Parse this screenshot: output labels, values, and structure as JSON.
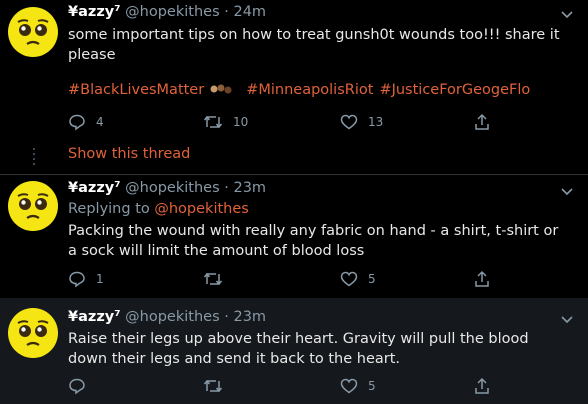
{
  "colors": {
    "background": "#000000",
    "accent": "#e0623a",
    "muted": "#8899a6",
    "avatar": "#f5e613"
  },
  "tweets": [
    {
      "name": "¥azzy⁷",
      "handle": "@hopekithes",
      "dot": "·",
      "time": "24m",
      "text": "some important tips on how to treat gunsh0t wounds too!!! share it please",
      "hashtags": [
        "#BlackLivesMatter",
        "#MinneapolisRiot",
        "#JusticeForGeogeFlo"
      ],
      "replies": "4",
      "retweets": "10",
      "likes": "13",
      "show_thread": "Show this thread"
    },
    {
      "name": "¥azzy⁷",
      "handle": "@hopekithes",
      "dot": "·",
      "time": "23m",
      "replying_to_prefix": "Replying to",
      "replying_to_handle": "@hopekithes",
      "text": "Packing the wound with really any fabric on hand - a shirt, t-shirt or a sock will limit the amount of blood loss",
      "replies": "1",
      "retweets": "",
      "likes": "5"
    },
    {
      "name": "¥azzy⁷",
      "handle": "@hopekithes",
      "dot": "·",
      "time": "23m",
      "text": "Raise their legs up above their heart. Gravity will pull the blood down their legs and send it back to the heart.",
      "replies": "",
      "retweets": "",
      "likes": "5"
    }
  ]
}
